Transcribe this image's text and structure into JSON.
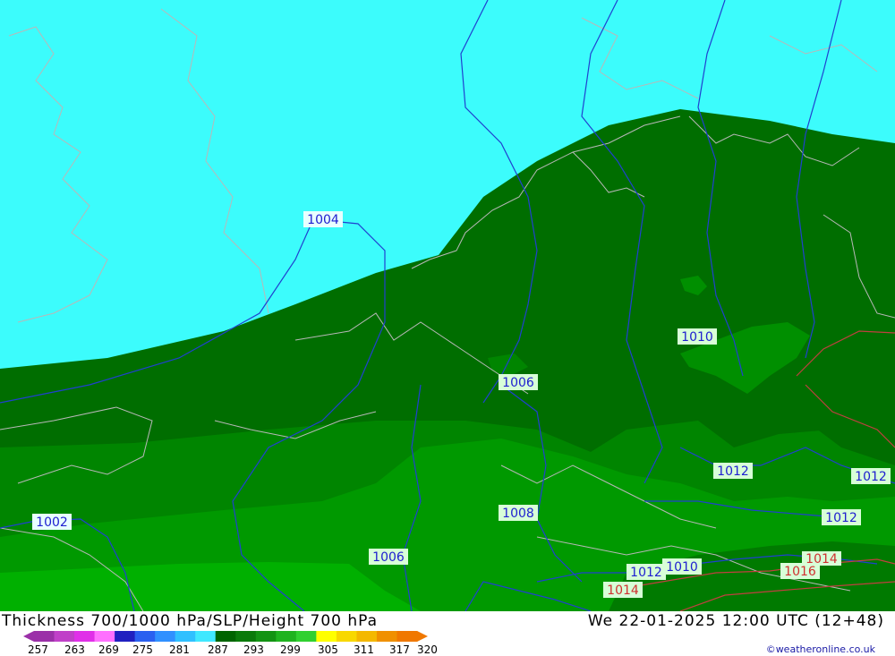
{
  "header": {
    "title": "Thickness 700/1000 hPa/SLP/Height 700 hPa",
    "datetime": "We 22-01-2025 12:00 UTC (12+48)"
  },
  "credit": "©weatheronline.co.uk",
  "legend": {
    "ticks": [
      "257",
      "263",
      "269",
      "275",
      "281",
      "287",
      "293",
      "299",
      "305",
      "311",
      "317",
      "320"
    ],
    "colors": [
      "#9b30a8",
      "#c040c8",
      "#e030e8",
      "#ff70ff",
      "#2020c0",
      "#2a60f0",
      "#3090ff",
      "#30c0ff",
      "#40e8ff",
      "#006400",
      "#0a7a0a",
      "#139313",
      "#1fb31f",
      "#30d030",
      "#ffff00",
      "#f8d800",
      "#f4b800",
      "#f09000",
      "#f07800"
    ]
  },
  "isobars": {
    "labels": [
      {
        "text": "1004",
        "color": "blue"
      },
      {
        "text": "1010",
        "color": "blue"
      },
      {
        "text": "1006",
        "color": "blue"
      },
      {
        "text": "1012",
        "color": "blue"
      },
      {
        "text": "1012",
        "color": "blue"
      },
      {
        "text": "1012",
        "color": "blue"
      },
      {
        "text": "1002",
        "color": "blue"
      },
      {
        "text": "1008",
        "color": "blue"
      },
      {
        "text": "1006",
        "color": "blue"
      },
      {
        "text": "1012",
        "color": "blue"
      },
      {
        "text": "1010",
        "color": "blue"
      },
      {
        "text": "1014",
        "color": "red"
      },
      {
        "text": "1016",
        "color": "red"
      },
      {
        "text": "1014",
        "color": "red"
      }
    ]
  },
  "map_colors": {
    "sea_cold": "#3cfcfc",
    "band_dark": "#006e00",
    "band_mid": "#008500",
    "band_light": "#009900",
    "band_bright": "#00b000",
    "coast": "#b0b0b0",
    "isobar_blue": "#2040d0",
    "isobar_red": "#c04040"
  }
}
